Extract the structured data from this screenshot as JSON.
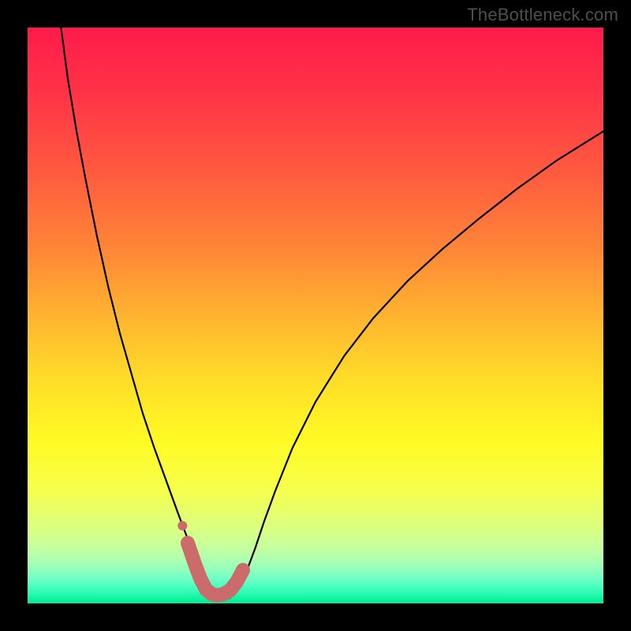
{
  "watermark": "TheBottleneck.com",
  "chart_data": {
    "type": "line",
    "title": "",
    "xlabel": "",
    "ylabel": "",
    "xlim": [
      0,
      100
    ],
    "ylim": [
      0,
      100
    ],
    "background_gradient_stops": [
      {
        "offset": 0.0,
        "color": "#ff1b4a"
      },
      {
        "offset": 0.12,
        "color": "#ff3547"
      },
      {
        "offset": 0.25,
        "color": "#ff5a3f"
      },
      {
        "offset": 0.38,
        "color": "#ff8437"
      },
      {
        "offset": 0.5,
        "color": "#ffb330"
      },
      {
        "offset": 0.62,
        "color": "#ffe028"
      },
      {
        "offset": 0.72,
        "color": "#fffb25"
      },
      {
        "offset": 0.8,
        "color": "#f7ff4a"
      },
      {
        "offset": 0.86,
        "color": "#dfff7a"
      },
      {
        "offset": 0.905,
        "color": "#c4ffa0"
      },
      {
        "offset": 0.935,
        "color": "#9effba"
      },
      {
        "offset": 0.958,
        "color": "#6effc6"
      },
      {
        "offset": 0.975,
        "color": "#3effbd"
      },
      {
        "offset": 0.99,
        "color": "#15f5a2"
      },
      {
        "offset": 1.0,
        "color": "#00ec8f"
      }
    ],
    "series": [
      {
        "name": "bottleneck-curve",
        "color": "#000000",
        "stroke_width": 2.2,
        "x": [
          5.8,
          7.0,
          8.5,
          10.0,
          12.0,
          14.0,
          16.0,
          18.0,
          20.0,
          22.0,
          24.0,
          26.0,
          27.5,
          29.0,
          30.0,
          31.0,
          32.0,
          33.0,
          34.0,
          35.2,
          36.5,
          38.0,
          39.5,
          41.0,
          43.0,
          46.0,
          50.0,
          55.0,
          60.0,
          66.0,
          72.0,
          78.0,
          85.0,
          92.0,
          100.0
        ],
        "y": [
          100.0,
          91.0,
          82.0,
          74.0,
          64.0,
          55.0,
          47.0,
          40.0,
          33.0,
          27.0,
          21.5,
          16.0,
          12.0,
          8.0,
          5.0,
          2.6,
          1.2,
          0.5,
          0.5,
          1.0,
          2.5,
          5.5,
          9.5,
          14.0,
          19.5,
          27.0,
          35.0,
          43.0,
          49.5,
          56.0,
          61.5,
          66.5,
          72.0,
          77.0,
          82.0
        ]
      },
      {
        "name": "highlight-band",
        "color": "#cc6b6b",
        "stroke_width": 18,
        "x": [
          27.8,
          29.0,
          30.0,
          31.0,
          32.0,
          33.0,
          34.0,
          35.2,
          36.3,
          37.4
        ],
        "y": [
          10.5,
          7.0,
          4.3,
          2.4,
          1.6,
          1.4,
          1.6,
          2.3,
          3.7,
          5.8
        ]
      },
      {
        "name": "highlight-dot",
        "color": "#cc6b6b",
        "type": "scatter",
        "marker_radius": 6,
        "x": [
          26.9
        ],
        "y": [
          13.5
        ]
      }
    ]
  }
}
